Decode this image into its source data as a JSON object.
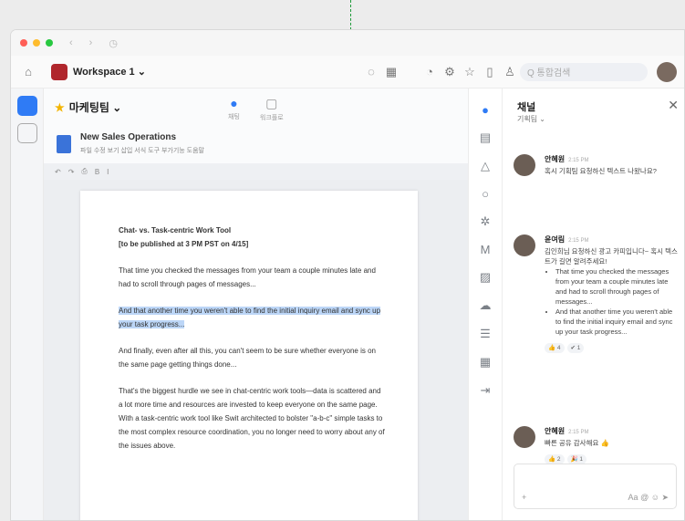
{
  "window": {
    "dots": [
      "#ff5f57",
      "#febc2e",
      "#28c840"
    ]
  },
  "toolbar": {
    "workspace_name": "Workspace 1 ⌄",
    "search_placeholder": "Q 통합검색"
  },
  "doc": {
    "chip_label": "마케팅팀 ⌄",
    "tabs": [
      {
        "label": "채팅"
      },
      {
        "label": "워크플로"
      }
    ],
    "title": "New Sales Operations",
    "menu": "파일 수정 보기 삽입 서식 도구 부가기능 도움말",
    "paragraphs": {
      "title": "Chat- vs. Task-centric Work Tool",
      "subtitle": "[to be published at 3 PM PST on 4/15]",
      "p1": "That time you checked the messages from your team a couple minutes late and had to scroll through pages of messages...",
      "p2": "And that another time you weren't able to find the initial inquiry email and sync up your task progress...",
      "p3": "And finally, even after all this, you can't seem to be sure whether everyone is on the same page getting things done...",
      "p4": "That's the biggest hurdle we see in chat-centric work tools—data is scattered and a lot more time and resources are invested to keep everyone on the same page. With a task-centric work tool like Swit architected to bolster \"a-b-c\" simple tasks to the most complex resource coordination, you no longer need to worry about any of the issues above."
    }
  },
  "chat": {
    "title": "채널",
    "subtitle": "기획팀 ⌄",
    "messages": [
      {
        "name": "안혜원",
        "time": "2:15 PM",
        "text": "혹시 기획팀 요청하신 텍스트 나왔나요?"
      },
      {
        "name": "윤여림",
        "time": "2:15 PM",
        "text": "김인희님 요청하신 광고 카피입니다~ 혹시 텍스트가 길면 알려주세요!",
        "bullets": [
          "That time you checked the messages from your team a couple minutes late and had to scroll through pages of messages...",
          "And that another time you weren't able to find the initial inquiry email and sync up your task progress..."
        ],
        "reacts": [
          "👍 4",
          "✔ 1"
        ]
      },
      {
        "name": "안혜원",
        "time": "2:15 PM",
        "text": "빠른 공유 감사해요 👍",
        "reacts": [
          "👍 2",
          "🎉 1"
        ]
      }
    ]
  }
}
